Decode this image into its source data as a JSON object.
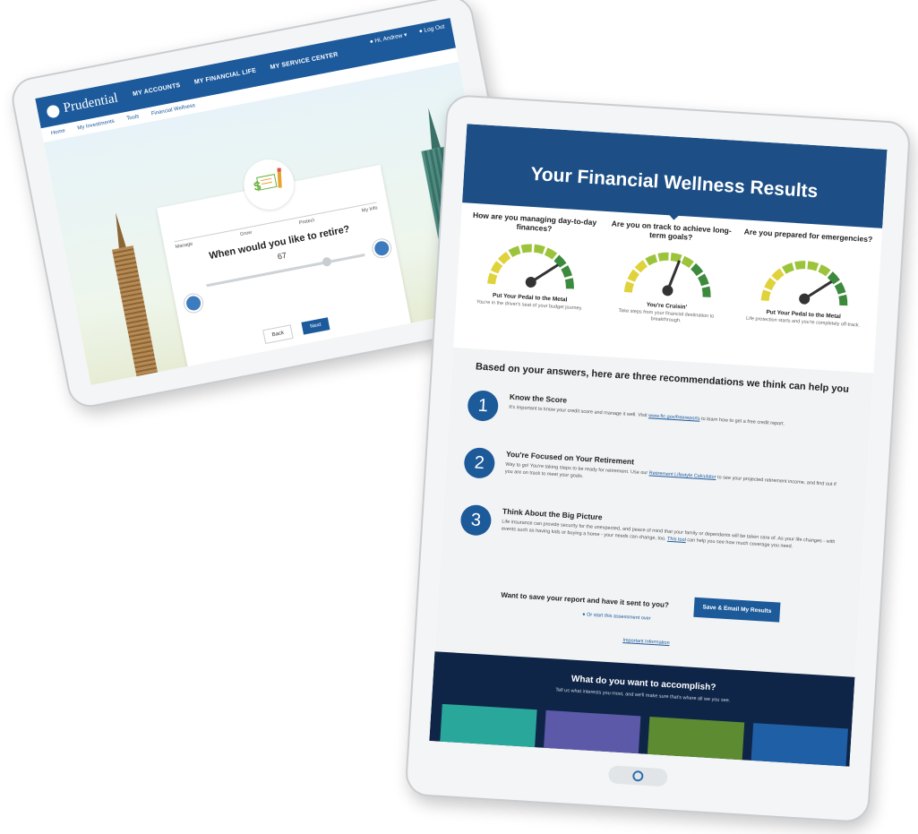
{
  "left_tablet": {
    "brand": "Prudential",
    "nav": [
      "MY ACCOUNTS",
      "MY FINANCIAL LIFE",
      "MY SERVICE CENTER"
    ],
    "user_menu": "Hi, Andrew",
    "logout": "Log Out",
    "breadcrumbs": [
      "Home",
      "My Investments",
      "Tools",
      "Financial Wellness"
    ],
    "steps": [
      "Manage",
      "Grow",
      "Protect",
      "My Info"
    ],
    "question": "When would you like to retire?",
    "slider_value": "67",
    "back_label": "Back",
    "next_label": "Next"
  },
  "right_tablet": {
    "title": "Your Financial Wellness Results",
    "gauges": [
      {
        "question": "How are you managing day-to-day finances?",
        "result": "Put Your Pedal to the Metal",
        "desc": "You're in the driver's seat of your budget journey.",
        "level": 0.8
      },
      {
        "question": "Are you on track to achieve long-term goals?",
        "result": "You're Cruisin'",
        "desc": "Take steps from your financial destination to breakthrough.",
        "level": 0.6
      },
      {
        "question": "Are you prepared for emergencies?",
        "result": "Put Your Pedal to the Metal",
        "desc": "Life protection starts and you're completely off-track.",
        "level": 0.8
      }
    ],
    "recs_title": "Based on your answers, here are three recommendations we think can help you",
    "recommendations": [
      {
        "num": "1",
        "title": "Know the Score",
        "text": "It's important to know your credit score and manage it well. Visit",
        "link": "www.ftc.gov/freereports",
        "text2": "to learn how to get a free credit report."
      },
      {
        "num": "2",
        "title": "You're Focused on Your Retirement",
        "text": "Way to go! You're taking steps to be ready for retirement. Use our",
        "link": "Retirement Lifestyle Calculator",
        "text2": "to see your projected retirement income, and find out if you are on track to meet your goals."
      },
      {
        "num": "3",
        "title": "Think About the Big Picture",
        "text": "Life insurance can provide security for the unexpected, and peace of mind that your family or dependents will be taken care of. As your life changes - with events such as having kids or buying a home - your needs can change, too.",
        "link": "This tool",
        "text2": "can help you see how much coverage you need."
      }
    ],
    "save_question": "Want to save your report and have it sent to you?",
    "save_button": "Save & Email My Results",
    "start_over": "Or start this assessment over",
    "important": "Important Information",
    "footer_title": "What do you want to accomplish?",
    "footer_sub": "Tell us what interests you most, and we'll make sure that's where all we you see.",
    "tile_colors": [
      "#2aa79b",
      "#5b59a8",
      "#5c8b32",
      "#1f5fa6"
    ]
  },
  "colors": {
    "nav_blue": "#1c5a9c",
    "dark_navy": "#0f2547",
    "gauge_yellow": "#e0d23a",
    "gauge_green": "#3c8a3c"
  }
}
